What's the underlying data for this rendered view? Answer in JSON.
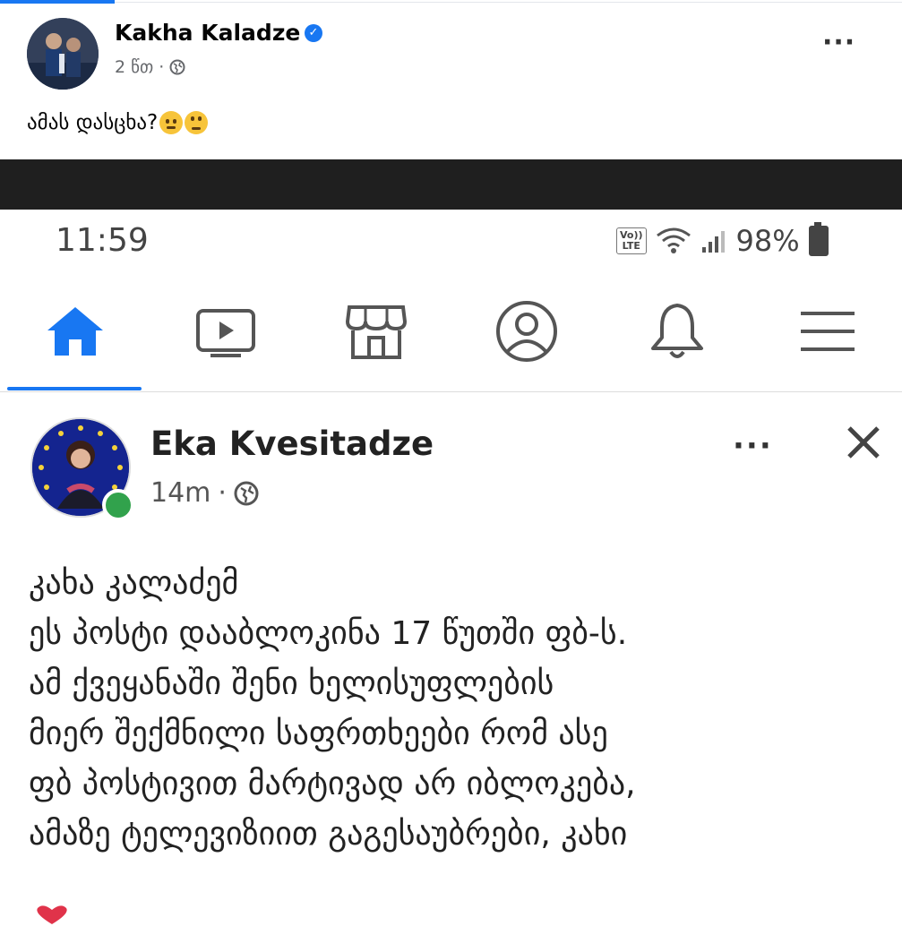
{
  "outer_post": {
    "author": "Kakha Kaladze",
    "time": "2 წთ",
    "text": "ამას  დასცხა?"
  },
  "status_bar": {
    "time": "11:59",
    "volte_line1": "Vo))",
    "volte_line2": "LTE",
    "battery": "98%"
  },
  "nav_tabs": [
    "home-icon",
    "video-icon",
    "marketplace-icon",
    "profile-icon",
    "bell-icon",
    "menu-icon"
  ],
  "inner_post": {
    "author": "Eka Kvesitadze",
    "time": "14m",
    "lines": [
      "კახა კალაძემ",
      "ეს პოსტი დააბლოკინა 17 წუთში ფბ-ს.",
      "ამ ქვეყანაში შენი ხელისუფლების",
      "მიერ შექმნილი საფრთხეები რომ ასე",
      "ფბ პოსტივით მარტივად არ იბლოკება,",
      "ამაზე ტელევიზიით გაგესაუბრები,  კახი"
    ]
  },
  "colors": {
    "accent": "#1877f2",
    "online": "#31a24c",
    "band": "#1f1f1f"
  }
}
